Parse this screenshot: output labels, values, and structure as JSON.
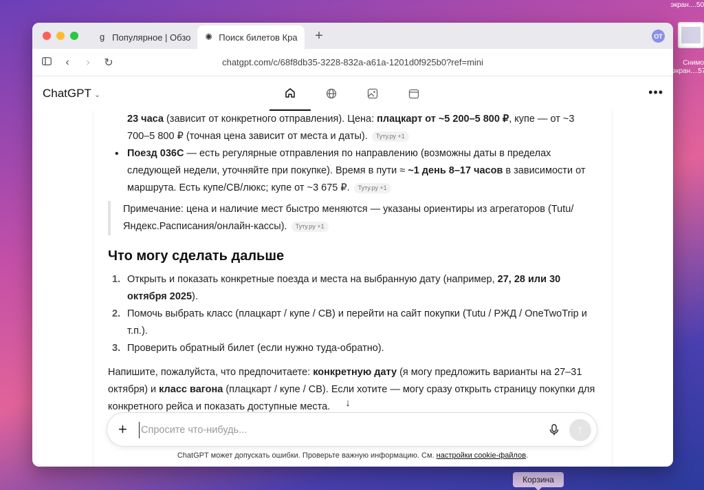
{
  "desktop": {
    "top_label": "экран....50",
    "thumb_label": "Снимо экран....57",
    "trash_tooltip": "Корзина"
  },
  "browser": {
    "tabs": [
      {
        "label": "Популярное | Обзор",
        "favicon": "g"
      },
      {
        "label": "Поиск билетов Крас",
        "favicon": "✺"
      }
    ],
    "profile_initials": "OT",
    "url": "chatgpt.com/c/68f8db35-3228-832a-a61a-1201d0f925b0?ref=mini"
  },
  "app": {
    "title": "ChatGPT",
    "tab_icons": [
      "home-icon",
      "globe-icon",
      "image-icon",
      "calendar-icon"
    ]
  },
  "message": {
    "item1_continued": {
      "b1": "23 часа",
      "t1": " (зависит от конкретного отправления). Цена: ",
      "b2": "плацкарт от ~5 200–5 800 ₽",
      "t2": ", купе — от ~3 700–5 800 ₽ (точная цена зависит от места и даты).",
      "cite": "Туту.ру +1"
    },
    "item2": {
      "b1": "Поезд 036С",
      "t1": " — есть регулярные отправления по направлению (возможны даты в пределах следующей недели, уточняйте при покупке). Время в пути ≈ ",
      "b2": "~1 день 8–17 часов",
      "t2": " в зависимости от маршрута. Есть купе/СВ/люкс; купе от ~3 675 ₽.",
      "cite": "Туту.ру +1"
    },
    "note": {
      "text": "Примечание: цена и наличие мест быстро меняются — указаны ориентиры из агрегаторов (Tutu/Яндекс.Расписания/онлайн-кассы).",
      "cite": "Туту.ру +1"
    },
    "heading": "Что могу сделать дальше",
    "steps": [
      {
        "n": "1.",
        "t1": "Открыть и показать конкретные поезда и места на выбранную дату (например, ",
        "b": "27, 28 или 30 октября 2025",
        "t2": ")."
      },
      {
        "n": "2.",
        "t1": "Помочь выбрать класс (плацкарт / купе / СВ) и перейти на сайт покупки (Tutu / РЖД / OneTwoTrip и т.п.).",
        "b": "",
        "t2": ""
      },
      {
        "n": "3.",
        "t1": "Проверить обратный билет (если нужно туда-обратно).",
        "b": "",
        "t2": ""
      }
    ],
    "closing": {
      "t1": "Напишите, пожалуйста, что предпочитаете: ",
      "b1": "конкретную дату",
      "t2": " (я могу предложить варианты на 27–31 октября) и ",
      "b2": "класс вагона",
      "t3": " (плацкарт / купе / СВ). Если хотите — могу сразу открыть страницу покупки для конкретного рейса и показать доступные места."
    }
  },
  "composer": {
    "placeholder": "Спросите что-нибудь..."
  },
  "footer": {
    "disclaimer": "ChatGPT может допускать ошибки. Проверьте важную информацию. См. ",
    "link": "настройки cookie-файлов",
    "end": "."
  }
}
